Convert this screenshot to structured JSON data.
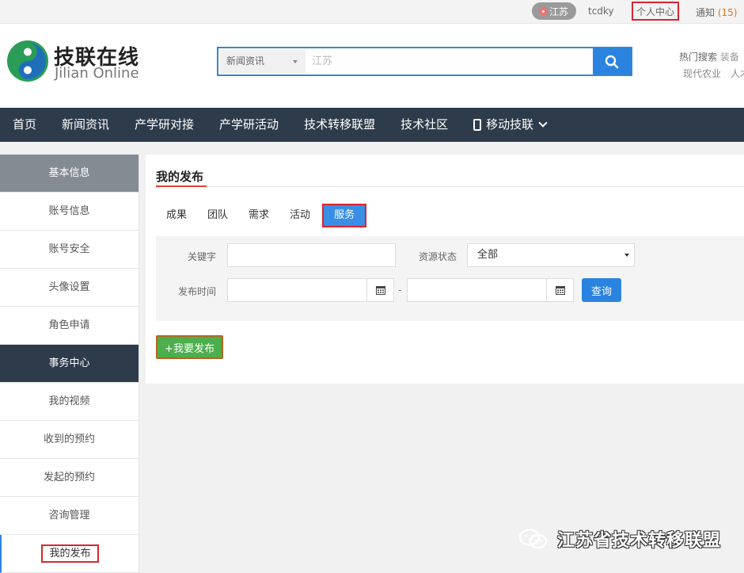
{
  "topbar": {
    "location": "江苏",
    "username": "tcdky",
    "personal_center": "个人中心",
    "notice_label": "通知",
    "notice_count": "(15)"
  },
  "header": {
    "logo_cn": "技联在线",
    "logo_en": "Jilian Online",
    "search": {
      "category": "新闻资讯",
      "placeholder": "江苏"
    },
    "hot_label": "热门搜索",
    "hot_clip": "装备",
    "hot_tags": [
      "现代农业",
      "人才"
    ]
  },
  "nav": {
    "items": [
      "首页",
      "新闻资讯",
      "产学研对接",
      "产学研活动",
      "技术转移联盟",
      "技术社区"
    ],
    "mobile": "移动技联"
  },
  "sidebar": {
    "group1": "基本信息",
    "group1_items": [
      "账号信息",
      "账号安全",
      "头像设置",
      "角色申请"
    ],
    "group2": "事务中心",
    "group2_items": [
      "我的视频",
      "收到的预约",
      "发起的预约",
      "咨询管理"
    ],
    "active": "我的发布"
  },
  "main": {
    "title": "我的发布",
    "tabs": [
      "成果",
      "团队",
      "需求",
      "活动"
    ],
    "active_tab": "服务",
    "filter": {
      "keyword_label": "关键字",
      "status_label": "资源状态",
      "status_value": "全部",
      "time_label": "发布时间",
      "dash": "-",
      "query": "查询"
    },
    "publish_button": "+我要发布"
  },
  "watermark": "江苏省技术转移联盟",
  "colors": {
    "nav_bg": "#2d3b4b",
    "accent_blue": "#2b83e0",
    "highlight_red": "#d9262f",
    "publish_green": "#4cae4c"
  }
}
